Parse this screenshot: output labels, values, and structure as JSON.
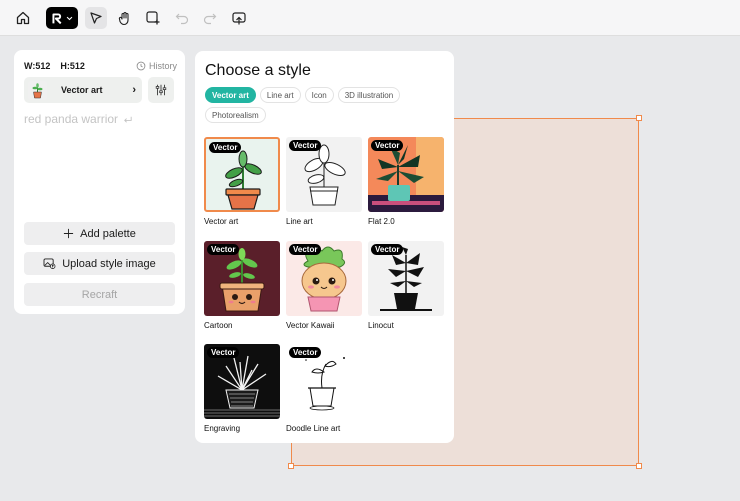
{
  "toolbar": {
    "icons": [
      "home-icon",
      "brand-logo",
      "chevron-down-icon",
      "pointer-icon",
      "hand-icon",
      "frame-add-icon",
      "undo-icon",
      "redo-icon",
      "export-icon"
    ]
  },
  "left_panel": {
    "width_label": "W:512",
    "height_label": "H:512",
    "history_label": "History",
    "style_name": "Vector art",
    "prompt_text": "red panda warrior",
    "add_palette_label": "Add palette",
    "upload_style_label": "Upload style image",
    "recraft_label": "Recraft"
  },
  "popup": {
    "title": "Choose a style",
    "tabs": [
      "Vector art",
      "Line art",
      "Icon",
      "3D illustration",
      "Photorealism"
    ],
    "active_tab": "Vector art",
    "badge_label": "Vector",
    "styles": [
      {
        "label": "Vector art",
        "selected": true
      },
      {
        "label": "Line art",
        "selected": false
      },
      {
        "label": "Flat 2.0",
        "selected": false
      },
      {
        "label": "Cartoon",
        "selected": false
      },
      {
        "label": "Vector Kawaii",
        "selected": false
      },
      {
        "label": "Linocut",
        "selected": false
      },
      {
        "label": "Engraving",
        "selected": false
      },
      {
        "label": "Doodle Line art",
        "selected": false
      }
    ]
  },
  "colors": {
    "accent": "#22b5a2",
    "selection": "#f08a4b",
    "canvas_fill": "#eddfd8"
  }
}
